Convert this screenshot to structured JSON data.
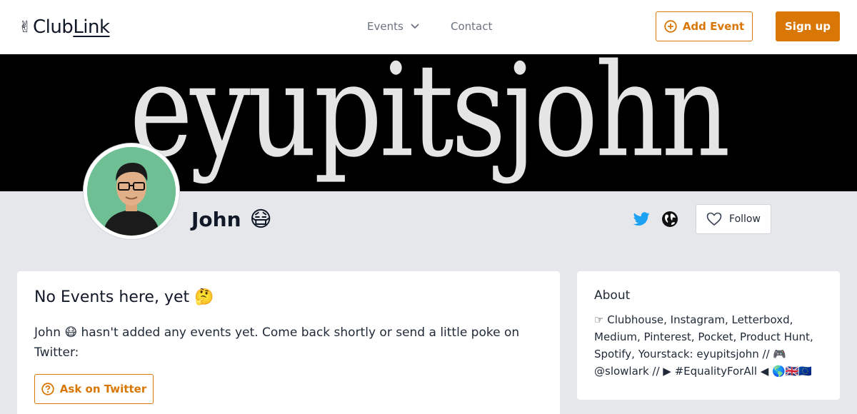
{
  "header": {
    "logo": {
      "hand": "✌",
      "part1": "Club",
      "part2": "Link"
    },
    "nav": {
      "events_label": "Events",
      "contact_label": "Contact"
    },
    "add_event_label": "Add Event",
    "signup_label": "Sign up"
  },
  "banner": {
    "text": "eyupitsjohn"
  },
  "profile": {
    "name": "John",
    "name_emoji": "😷",
    "follow_label": "Follow",
    "icons": [
      "twitter-icon",
      "globe-icon",
      "heart-icon"
    ]
  },
  "events_card": {
    "title": "No Events here, yet 🤔",
    "message": "John 😷 hasn't added any events yet. Come back shortly or send a little poke on Twitter:",
    "ask_label": "Ask on Twitter"
  },
  "about_card": {
    "title": "About",
    "text": "☞ Clubhouse, Instagram, Letterboxd, Medium, Pinterest, Pocket, Product Hunt, Spotify, Yourstack: eyupitsjohn // 🎮 @slowlark // ▶ #EqualityForAll ◀ 🌎🇬🇧🇪🇺"
  },
  "colors": {
    "accent": "#d97706",
    "page_bg": "#e5e7eb",
    "banner_bg": "#000000",
    "twitter": "#1da1f2",
    "avatar_bg": "#6fbf95"
  }
}
